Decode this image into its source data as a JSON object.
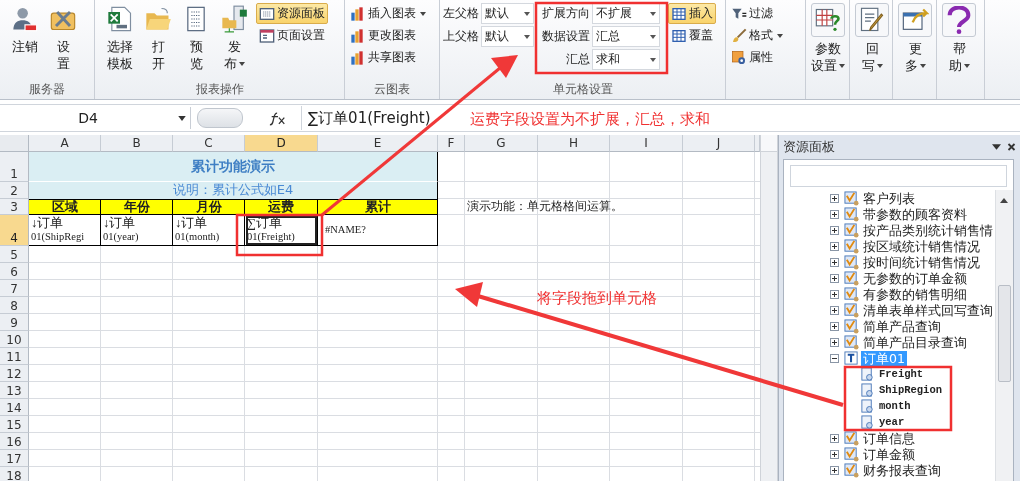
{
  "ribbon": {
    "groups": [
      {
        "label": "服务器",
        "sections": [
          {
            "kind": "large",
            "buttons": [
              {
                "lines": [
                  "注销"
                ],
                "dropdown": false
              },
              {
                "lines": [
                  "设",
                  "置"
                ],
                "dropdown": false
              }
            ]
          }
        ]
      },
      {
        "label": "报表操作",
        "sections": [
          {
            "kind": "large",
            "buttons": [
              {
                "lines": [
                  "选择",
                  "模板"
                ],
                "dropdown": false
              },
              {
                "lines": [
                  "打",
                  "开"
                ],
                "dropdown": false
              },
              {
                "lines": [
                  "预",
                  "览"
                ],
                "dropdown": false
              },
              {
                "lines": [
                  "发",
                  "布"
                ],
                "dropdown": true
              }
            ]
          },
          {
            "kind": "small",
            "buttons": [
              {
                "label": "资源面板",
                "dropdown": false,
                "selected": true
              },
              {
                "label": "页面设置",
                "dropdown": false,
                "selected": false
              }
            ]
          }
        ]
      },
      {
        "label": "云图表",
        "sections": [
          {
            "kind": "small",
            "buttons": [
              {
                "label": "插入图表",
                "dropdown": true,
                "selected": false
              },
              {
                "label": "更改图表",
                "dropdown": false,
                "selected": false
              },
              {
                "label": "共享图表",
                "dropdown": false,
                "selected": false
              }
            ]
          }
        ]
      },
      {
        "label": "单元格设置",
        "sections": [
          {
            "kind": "fields",
            "fields": [
              {
                "label": "左父格",
                "value": "默认"
              },
              {
                "label": "上父格",
                "value": "默认"
              }
            ]
          },
          {
            "kind": "fields",
            "fields": [
              {
                "label": "扩展方向",
                "value": "不扩展"
              },
              {
                "label": "数据设置",
                "value": "汇总"
              },
              {
                "label": "汇总",
                "value": "求和"
              }
            ]
          },
          {
            "kind": "small",
            "buttons": [
              {
                "label": "插入",
                "dropdown": false,
                "selected": true
              },
              {
                "label": "覆盖",
                "dropdown": false,
                "selected": false
              }
            ]
          }
        ]
      },
      {
        "sections": [
          {
            "kind": "small",
            "buttons": [
              {
                "label": "过滤",
                "dropdown": false,
                "selected": false
              },
              {
                "label": "格式",
                "dropdown": true,
                "selected": false
              },
              {
                "label": "属性",
                "dropdown": false,
                "selected": false
              }
            ]
          }
        ]
      },
      {
        "sections": [
          {
            "kind": "large",
            "buttons": [
              {
                "lines": [
                  "参数",
                  "设置"
                ],
                "dropdown": true
              }
            ]
          }
        ]
      },
      {
        "sections": [
          {
            "kind": "large",
            "buttons": [
              {
                "lines": [
                  "回",
                  "写"
                ],
                "dropdown": true
              }
            ]
          }
        ]
      },
      {
        "sections": [
          {
            "kind": "large",
            "buttons": [
              {
                "lines": [
                  "更",
                  "多"
                ],
                "dropdown": true
              }
            ]
          }
        ]
      },
      {
        "sections": [
          {
            "kind": "large",
            "buttons": [
              {
                "lines": [
                  "帮",
                  "助"
                ],
                "dropdown": true
              }
            ]
          }
        ]
      }
    ]
  },
  "formula_bar": {
    "name_box": "D4",
    "formula": "∑订单01(Freight)"
  },
  "sheet": {
    "columns": [
      {
        "label": "A",
        "selected": false
      },
      {
        "label": "B",
        "selected": false
      },
      {
        "label": "C",
        "selected": false
      },
      {
        "label": "D",
        "selected": true
      },
      {
        "label": "E",
        "selected": false
      },
      {
        "label": "F",
        "selected": false
      },
      {
        "label": "G",
        "selected": false
      },
      {
        "label": "H",
        "selected": false
      },
      {
        "label": "I",
        "selected": false
      },
      {
        "label": "J",
        "selected": false
      }
    ],
    "rows": [
      {
        "number": "1",
        "selected": false
      },
      {
        "number": "2",
        "selected": false
      },
      {
        "number": "3",
        "selected": false
      },
      {
        "number": "4",
        "selected": true
      },
      {
        "number": "5",
        "selected": false
      },
      {
        "number": "6",
        "selected": false
      },
      {
        "number": "7",
        "selected": false
      },
      {
        "number": "8",
        "selected": false
      },
      {
        "number": "9",
        "selected": false
      },
      {
        "number": "10",
        "selected": false
      },
      {
        "number": "11",
        "selected": false
      },
      {
        "number": "12",
        "selected": false
      },
      {
        "number": "13",
        "selected": false
      },
      {
        "number": "14",
        "selected": false
      },
      {
        "number": "15",
        "selected": false
      },
      {
        "number": "16",
        "selected": false
      },
      {
        "number": "17",
        "selected": false
      },
      {
        "number": "18",
        "selected": false
      }
    ],
    "title": "累计功能演示",
    "note": "说明：累计公式如E4",
    "headers": [
      "区域",
      "年份",
      "月份",
      "运费",
      "累计"
    ],
    "data_row": [
      {
        "lines": [
          "↓订单",
          "01(ShipRegi"
        ],
        "selected": false
      },
      {
        "lines": [
          "↓订单",
          "01(year)"
        ],
        "selected": false
      },
      {
        "lines": [
          "↓订单",
          "01(month)"
        ],
        "selected": false
      },
      {
        "lines": [
          "∑订单",
          "01(Freight)"
        ],
        "selected": true
      },
      {
        "lines": [
          "#NAME?"
        ],
        "selected": false
      }
    ],
    "side_note": "演示功能：单元格格间运算。"
  },
  "panel": {
    "title": "资源面板",
    "tree": [
      {
        "label": "客户列表",
        "kind": "report",
        "expanded": false,
        "selected": false
      },
      {
        "label": "带参数的顾客资料",
        "kind": "report",
        "expanded": false,
        "selected": false
      },
      {
        "label": "按产品类别统计销售情",
        "kind": "report",
        "expanded": false,
        "selected": false
      },
      {
        "label": "按区域统计销售情况",
        "kind": "report",
        "expanded": false,
        "selected": false
      },
      {
        "label": "按时间统计销售情况",
        "kind": "report",
        "expanded": false,
        "selected": false
      },
      {
        "label": "无参数的订单金额",
        "kind": "report",
        "expanded": false,
        "selected": false
      },
      {
        "label": "有参数的销售明细",
        "kind": "report",
        "expanded": false,
        "selected": false
      },
      {
        "label": "清单表单样式回写查询",
        "kind": "report",
        "expanded": false,
        "selected": false
      },
      {
        "label": "简单产品查询",
        "kind": "report",
        "expanded": false,
        "selected": false
      },
      {
        "label": "简单产品目录查询",
        "kind": "report",
        "expanded": false,
        "selected": false
      },
      {
        "label": "订单01",
        "kind": "table",
        "expanded": true,
        "selected": true,
        "children": [
          {
            "label": "Freight",
            "kind": "field",
            "selected": false
          },
          {
            "label": "ShipRegion",
            "kind": "field",
            "selected": false
          },
          {
            "label": "month",
            "kind": "field",
            "selected": false
          },
          {
            "label": "year",
            "kind": "field",
            "selected": false
          }
        ]
      },
      {
        "label": "订单信息",
        "kind": "report",
        "expanded": false,
        "selected": false
      },
      {
        "label": "订单金额",
        "kind": "report",
        "expanded": false,
        "selected": false
      },
      {
        "label": "财务报表查询",
        "kind": "report",
        "expanded": false,
        "selected": false
      }
    ]
  },
  "annotations": [
    {
      "kind": "callout",
      "text": "运费字段设置为不扩展，汇总，求和"
    },
    {
      "kind": "callout",
      "text": "将字段拖到单元格"
    }
  ]
}
